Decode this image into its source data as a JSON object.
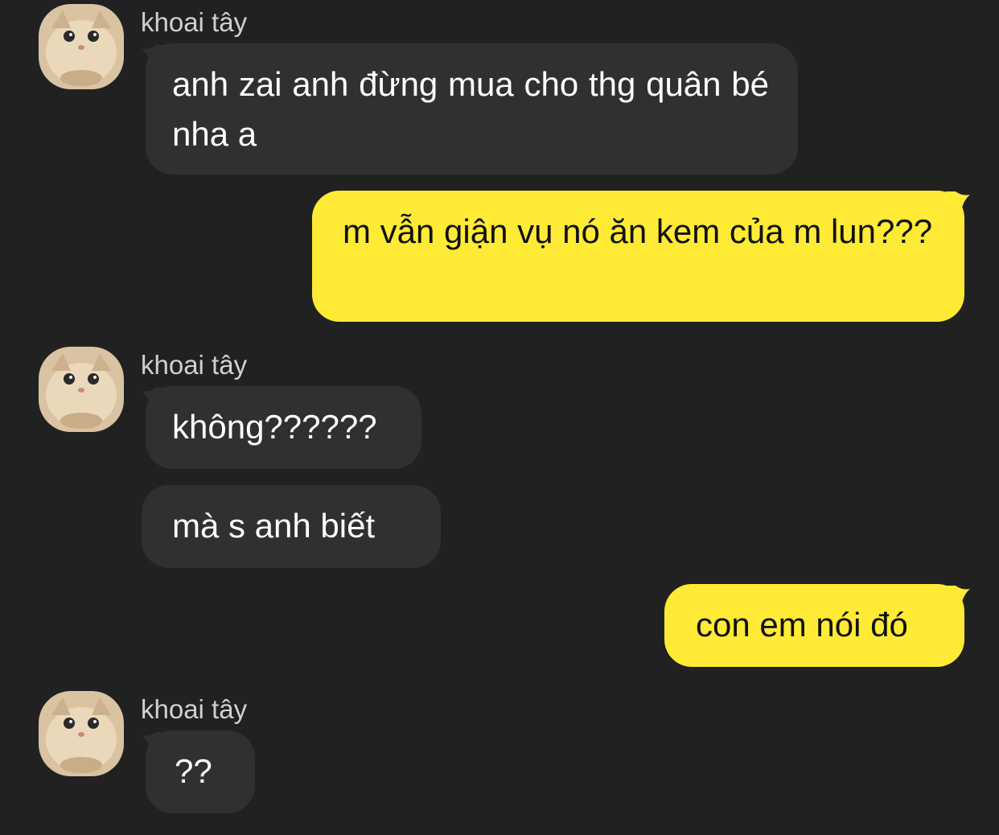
{
  "conversation": {
    "messages": [
      {
        "from": "them",
        "sender": "khoai tây",
        "text": "anh zai anh đừng mua cho thg quân bé nha a"
      },
      {
        "from": "me",
        "text": "m vẫn giận vụ nó ăn kem của m lun???"
      },
      {
        "from": "them",
        "sender": "khoai tây",
        "text": "không??????"
      },
      {
        "from": "them",
        "text": "mà s anh biết"
      },
      {
        "from": "me",
        "text": "con em nói đó"
      },
      {
        "from": "them",
        "sender": "khoai tây",
        "text": "??"
      }
    ]
  },
  "colors": {
    "background": "#212121",
    "incoming_bubble": "#303030",
    "outgoing_bubble": "#ffeb35",
    "incoming_text": "#ffffff",
    "outgoing_text": "#111111",
    "sender_name": "#d0d0d0"
  },
  "icons": {
    "avatar": "cat-avatar-photo"
  }
}
